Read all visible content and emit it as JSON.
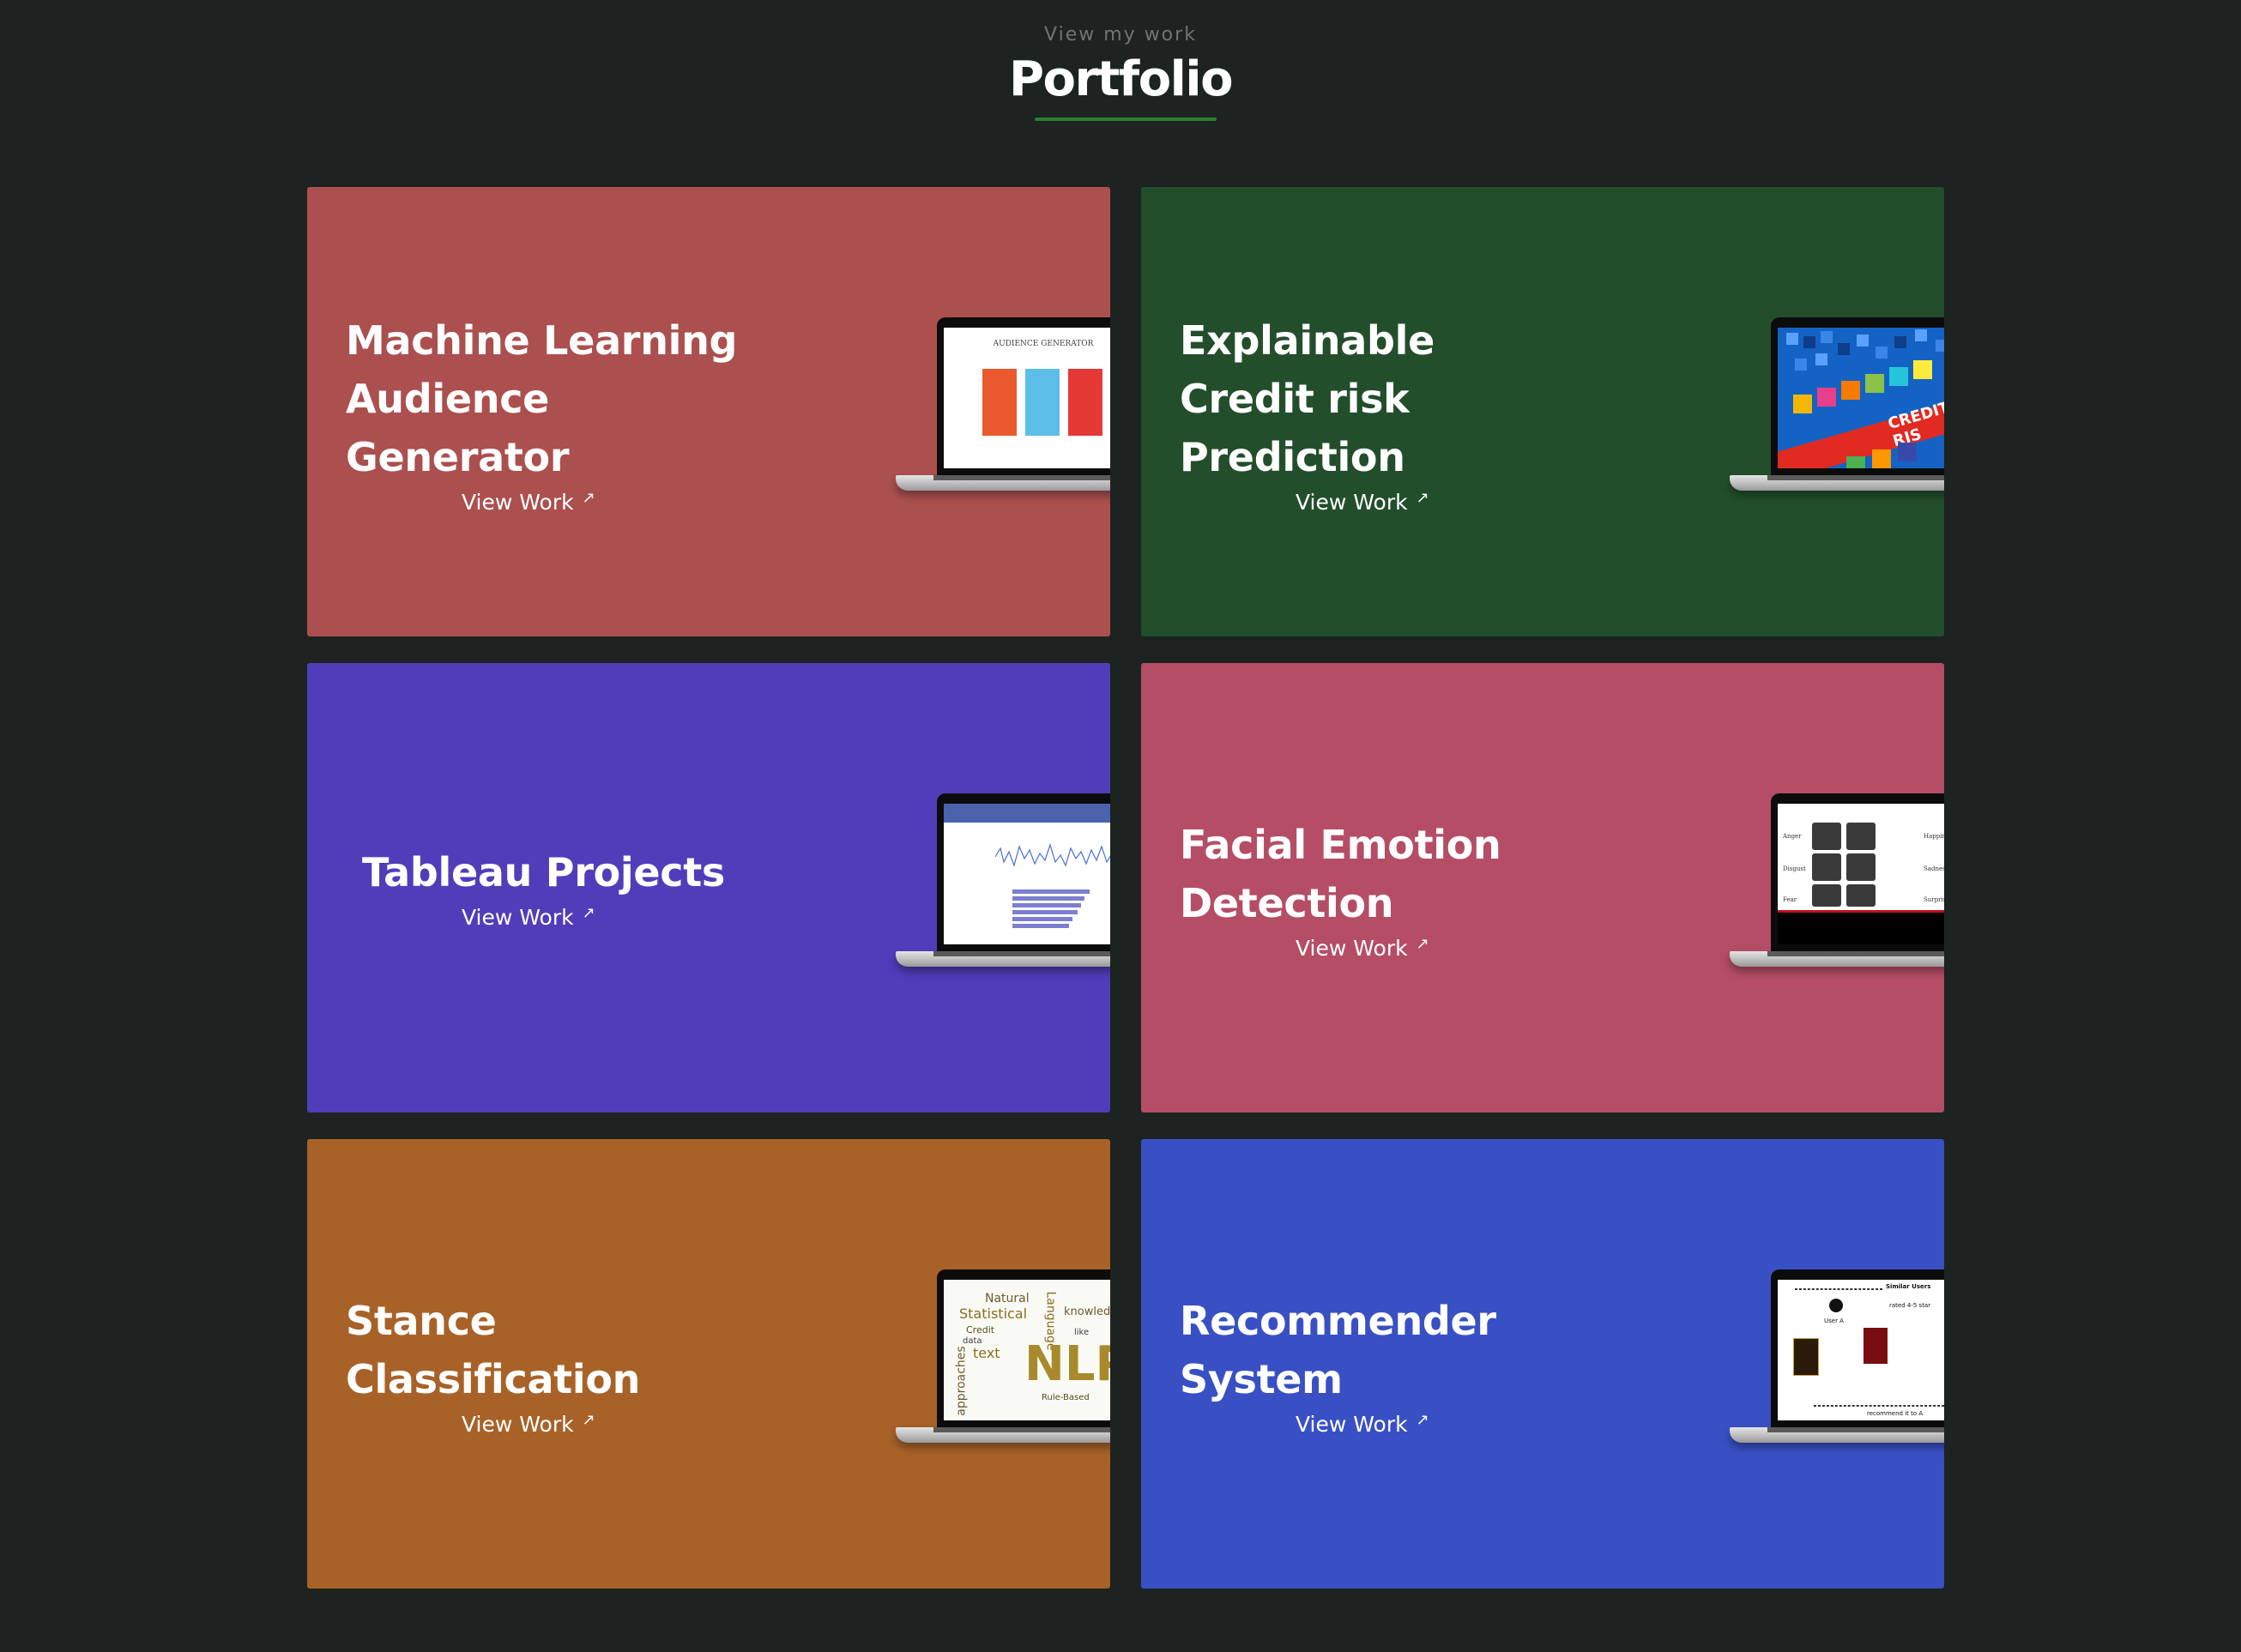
{
  "header": {
    "eyebrow": "View my work",
    "title": "Portfolio"
  },
  "colors": {
    "background": "#1c2320",
    "underline": "#2e7d32"
  },
  "cards": [
    {
      "title_lines": [
        "Machine Learning",
        "Audience",
        "Generator"
      ],
      "link": "View Work",
      "color": "#ac4f4f",
      "screen": "audience-generator"
    },
    {
      "title_lines": [
        "Explainable",
        "Credit risk",
        "Prediction"
      ],
      "link": "View Work",
      "color": "#234e2c",
      "screen": "credit-risk"
    },
    {
      "title_lines": [
        "Tableau Projects"
      ],
      "link": "View Work",
      "color": "#513dba",
      "screen": "tableau-dashboard"
    },
    {
      "title_lines": [
        "Facial Emotion",
        "Detection"
      ],
      "link": "View Work",
      "color": "#b54d66",
      "screen": "facial-emotion"
    },
    {
      "title_lines": [
        "Stance",
        "Classification"
      ],
      "link": "View Work",
      "color": "#a86228",
      "screen": "nlp-word-cloud"
    },
    {
      "title_lines": [
        "Recommender",
        "System"
      ],
      "link": "View Work",
      "color": "#3950c4",
      "screen": "recommender-diagram"
    }
  ],
  "screens": {
    "audience_title": "AUDIENCE GENERATOR",
    "credit_band": "CREDIT RIS",
    "emotion_labels": [
      "Anger",
      "Disgust",
      "Fear",
      "Happiness",
      "Sadness",
      "Surprise"
    ],
    "nlp_words": [
      "Natural",
      "Statistical",
      "Credit",
      "data",
      "text",
      "approaches",
      "Language",
      "knowledge",
      "NLP",
      "Rule-Based",
      "like"
    ],
    "rec_labels": [
      "Similar Users",
      "User A",
      "rated 4-5 star",
      "recommend it to A"
    ]
  },
  "arrow_glyph": "↗"
}
